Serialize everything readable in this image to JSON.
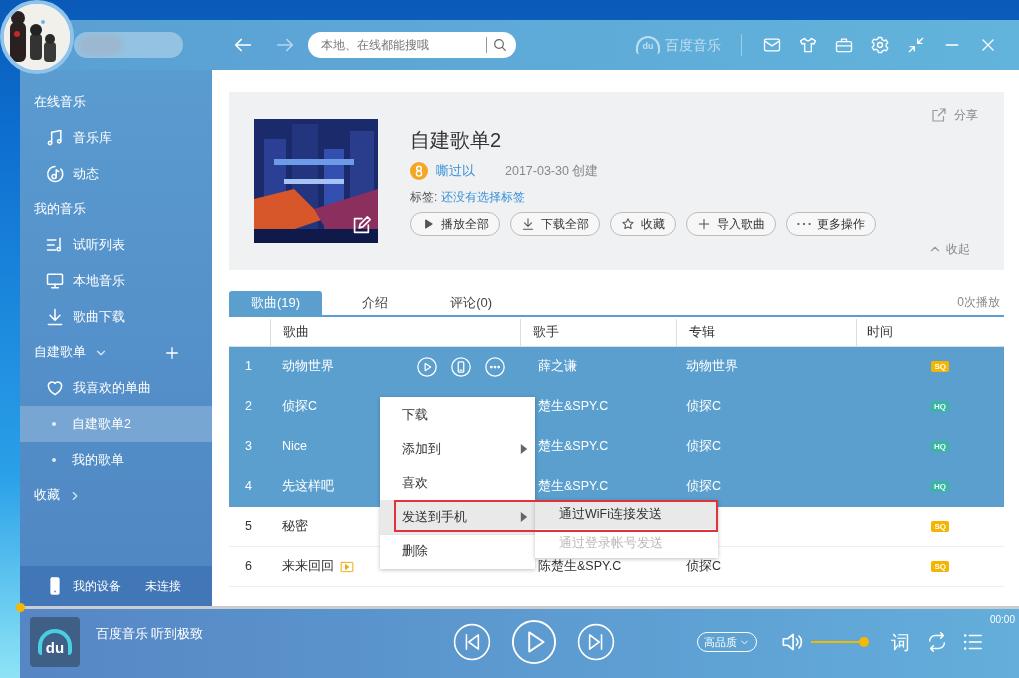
{
  "search": {
    "placeholder": "本地、在线都能搜哦"
  },
  "brand": {
    "logo_text": "du",
    "name": "百度音乐"
  },
  "sidebar": {
    "sections": [
      {
        "title": "在线音乐",
        "items": [
          {
            "label": "音乐库",
            "selected": false
          },
          {
            "label": "动态",
            "selected": false
          }
        ]
      },
      {
        "title": "我的音乐",
        "items": [
          {
            "label": "试听列表",
            "selected": false
          },
          {
            "label": "本地音乐",
            "selected": false
          },
          {
            "label": "歌曲下载",
            "selected": false
          }
        ]
      },
      {
        "title": "自建歌单",
        "expanded": true,
        "addable": true,
        "items": [
          {
            "label": "我喜欢的单曲",
            "kind": "liked",
            "selected": false
          },
          {
            "label": "自建歌单2",
            "kind": "playlist",
            "selected": true
          },
          {
            "label": "我的歌单",
            "kind": "playlist",
            "selected": false
          }
        ]
      },
      {
        "title": "收藏",
        "expanded": false
      }
    ],
    "device": {
      "label": "我的设备",
      "status": "未连接"
    }
  },
  "playlist": {
    "title": "自建歌单2",
    "creator": "嘶过以",
    "created": "2017-03-30 创建",
    "tags_label": "标签:",
    "tags": "还没有选择标签",
    "share": "分享",
    "collapse": "收起",
    "actions": [
      "播放全部",
      "下载全部",
      "收藏",
      "导入歌曲",
      "更多操作"
    ]
  },
  "tabs": [
    {
      "label": "歌曲(19)",
      "selected": true
    },
    {
      "label": "介绍",
      "selected": false
    },
    {
      "label": "评论(0)",
      "selected": false
    }
  ],
  "play_count": "0次播放",
  "table": {
    "columns": [
      "歌曲",
      "歌手",
      "专辑",
      "时间"
    ],
    "rows": [
      {
        "index": "1",
        "title": "动物世界",
        "artist": "薛之谦",
        "album": "动物世界",
        "quality": "SQ",
        "selected": true,
        "hovered": true,
        "mv": false
      },
      {
        "index": "2",
        "title": "侦探C",
        "artist": "楚生&SPY.C",
        "album": "侦探C",
        "quality": "HQ",
        "selected": true,
        "hovered": false,
        "mv": false
      },
      {
        "index": "3",
        "title": "Nice",
        "artist": "楚生&SPY.C",
        "album": "侦探C",
        "quality": "HQ",
        "selected": true,
        "hovered": false,
        "mv": false
      },
      {
        "index": "4",
        "title": "先这样吧",
        "artist": "楚生&SPY.C",
        "album": "侦探C",
        "quality": "HQ",
        "selected": true,
        "hovered": false,
        "mv": false
      },
      {
        "index": "5",
        "title": "秘密",
        "quality": "SQ",
        "selected": false,
        "hovered": false,
        "mv": false
      },
      {
        "index": "6",
        "title": "来来回回",
        "artist": "陈楚生&SPY.C",
        "album": "侦探C",
        "quality": "SQ",
        "selected": false,
        "hovered": false,
        "mv": true
      }
    ]
  },
  "context_menu": {
    "items": [
      {
        "label": "下载",
        "submenu": false,
        "highlighted": false
      },
      {
        "label": "添加到",
        "submenu": true,
        "highlighted": false
      },
      {
        "label": "喜欢",
        "submenu": false,
        "highlighted": false
      },
      {
        "label": "发送到手机",
        "submenu": true,
        "highlighted": true,
        "outlined": true
      },
      {
        "label": "删除",
        "submenu": false,
        "highlighted": false
      }
    ],
    "submenu": [
      {
        "label": "通过WiFi连接发送",
        "highlighted": true,
        "disabled": false
      },
      {
        "label": "通过登录帐号发送",
        "highlighted": false,
        "disabled": true
      }
    ]
  },
  "player": {
    "logo_text": "du",
    "title": "百度音乐 听到极致",
    "quality": "高品质",
    "lyrics": "词",
    "time": "00:00",
    "progress": {
      "level": 0
    },
    "volume": {
      "level": 1
    }
  }
}
